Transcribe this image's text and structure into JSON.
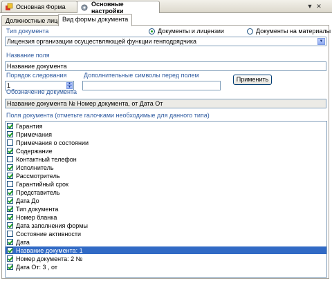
{
  "doc_tabs": [
    {
      "label": "Основная Форма",
      "icon": "form-icon"
    },
    {
      "label": "Основные настройки",
      "icon": "settings-icon",
      "active": true
    }
  ],
  "inner_tabs": [
    {
      "label": "Должностные лица"
    },
    {
      "label": "Вид формы документа",
      "active": true
    }
  ],
  "doc_type": {
    "label": "Тип документа",
    "radio_docs_licenses": "Документы и лицензии",
    "radio_docs_materials": "Документы на материалы",
    "selected_radio": "docs_licenses",
    "select_value": "Лицензия организации осуществляющей функции генподрядчика"
  },
  "field_name": {
    "label": "Название поля",
    "value": "Название документа"
  },
  "order": {
    "label": "Порядок следования",
    "value": "1"
  },
  "extra_symbols": {
    "label": "Дополнительные символы перед полем",
    "value": ""
  },
  "apply_button": "Применить",
  "designation": {
    "label": "Обозначение документа",
    "value": "Название документа № Номер документа, от Дата От"
  },
  "fields_list": {
    "label": "Поля документа (отметьте галочками необходимые для данного типа)",
    "items": [
      {
        "text": "Гарантия",
        "checked": true
      },
      {
        "text": "Примечания",
        "checked": true
      },
      {
        "text": "Примечания о состоянии",
        "checked": false
      },
      {
        "text": "Содержание",
        "checked": true
      },
      {
        "text": "Контактный телефон",
        "checked": false
      },
      {
        "text": "Исполнитель",
        "checked": true
      },
      {
        "text": "Рассмотритель",
        "checked": true
      },
      {
        "text": "Гарантийный срок",
        "checked": false
      },
      {
        "text": "Представитель",
        "checked": true
      },
      {
        "text": "Дата До",
        "checked": true
      },
      {
        "text": "Тип документа",
        "checked": true
      },
      {
        "text": "Номер бланка",
        "checked": true
      },
      {
        "text": "Дата заполнения формы",
        "checked": true
      },
      {
        "text": "Состояние активности",
        "checked": false
      },
      {
        "text": "Дата",
        "checked": true
      },
      {
        "text": "Название документа: 1",
        "checked": true,
        "selected": true
      },
      {
        "text": "Номер документа: 2  №",
        "checked": true
      },
      {
        "text": "Дата От: 3 , от",
        "checked": true
      }
    ]
  }
}
